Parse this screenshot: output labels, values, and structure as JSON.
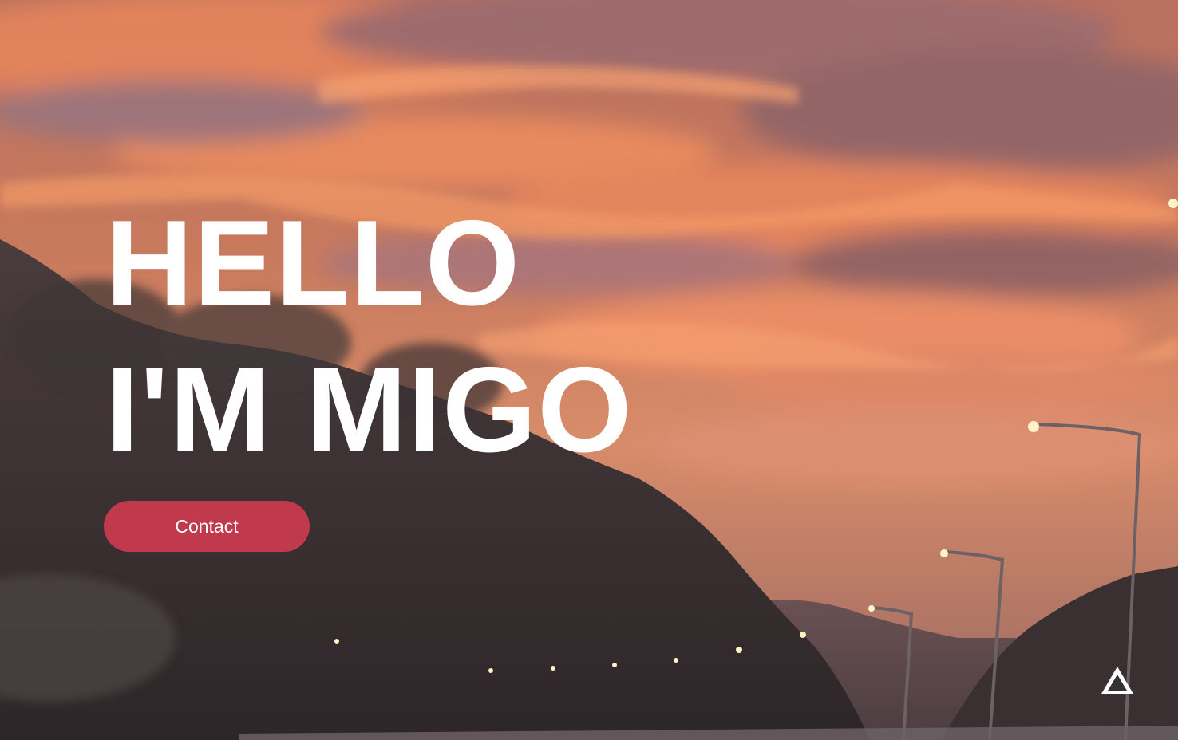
{
  "hero": {
    "line1": "HELLO",
    "line2": "I'M MIGO"
  },
  "contact_button": {
    "label": "Contact"
  },
  "background": {
    "description_icon": "sunset-highway-photo",
    "button_color": "#c0394d",
    "text_color": "#ffffff"
  }
}
